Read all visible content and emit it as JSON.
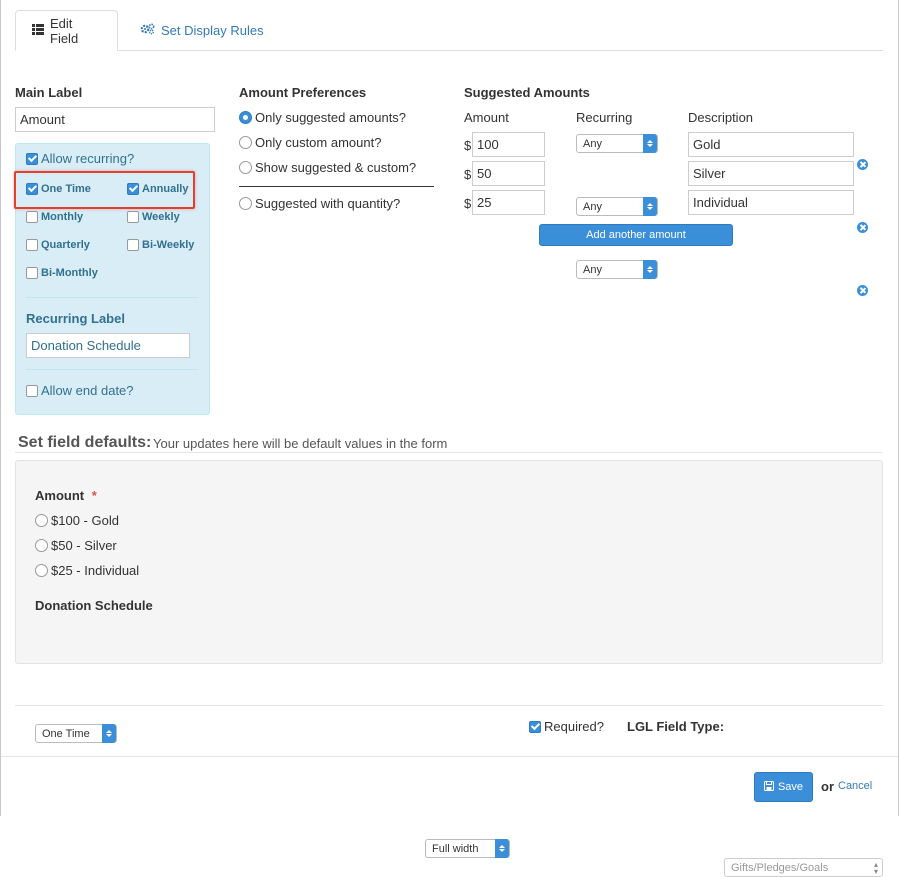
{
  "tabs": [
    {
      "label": "Edit Field",
      "icon": "list-icon"
    },
    {
      "label": "Set Display Rules",
      "icon": "gears-icon"
    }
  ],
  "main_label": {
    "title": "Main Label",
    "value": "Amount"
  },
  "recurring": {
    "allow_label": "Allow recurring?",
    "allow_checked": true,
    "options": [
      {
        "label": "One Time",
        "checked": true
      },
      {
        "label": "Annually",
        "checked": true
      },
      {
        "label": "Monthly",
        "checked": false
      },
      {
        "label": "Weekly",
        "checked": false
      },
      {
        "label": "Quarterly",
        "checked": false
      },
      {
        "label": "Bi-Weekly",
        "checked": false
      },
      {
        "label": "Bi-Monthly",
        "checked": false
      }
    ],
    "recurring_label_title": "Recurring Label",
    "recurring_label_value": "Donation Schedule",
    "allow_end_date_label": "Allow end date?"
  },
  "amount_preferences": {
    "title": "Amount Preferences",
    "options": [
      {
        "label": "Only suggested amounts?",
        "selected": true
      },
      {
        "label": "Only custom amount?",
        "selected": false
      },
      {
        "label": "Show suggested & custom?",
        "selected": false
      },
      {
        "label": "Suggested with quantity?",
        "selected": false
      }
    ]
  },
  "suggested_amounts": {
    "title": "Suggested Amounts",
    "headers": {
      "amount": "Amount",
      "recurring": "Recurring",
      "description": "Description"
    },
    "currency": "$",
    "rows": [
      {
        "amount": "100",
        "recurring": "Any",
        "description": "Gold"
      },
      {
        "amount": "50",
        "recurring": "Any",
        "description": "Silver"
      },
      {
        "amount": "25",
        "recurring": "Any",
        "description": "Individual"
      }
    ],
    "add_button": "Add another amount"
  },
  "defaults": {
    "title": "Set field defaults:",
    "subtitle": "Your updates here will be default values in the form",
    "amount_label": "Amount",
    "required_mark": "*",
    "amount_options": [
      "$100 - Gold",
      "$50 - Silver",
      "$25 - Individual"
    ],
    "schedule_label": "Donation Schedule",
    "schedule_value": "One Time"
  },
  "footer": {
    "width_value": "Full width",
    "required_label": "Required?",
    "required_checked": true,
    "lgl_label": "LGL Field Type:",
    "lgl_value": "Gifts/Pledges/Goals",
    "save_label": "Save",
    "or_text": "or",
    "cancel_label": "Cancel"
  }
}
